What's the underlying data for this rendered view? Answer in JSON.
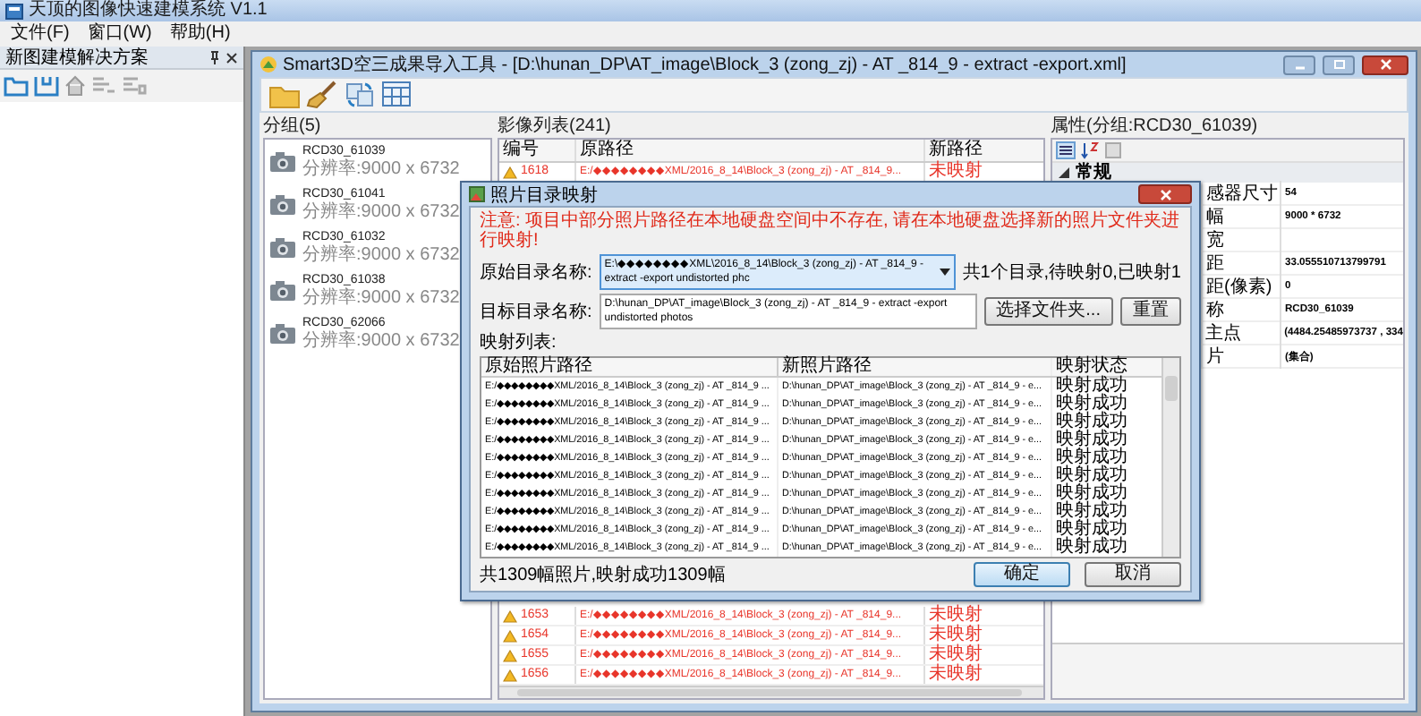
{
  "app": {
    "title": "天顶的图像快速建模系统 V1.1"
  },
  "menu": [
    {
      "label": "文件(F)"
    },
    {
      "label": "窗口(W)"
    },
    {
      "label": "帮助(H)"
    }
  ],
  "solution_panel": {
    "title": "新图建模解决方案"
  },
  "tool_window": {
    "title": "Smart3D空三成果导入工具 - [D:\\hunan_DP\\AT_image\\Block_3 (zong_zj) - AT _814_9 - extract -export.xml]",
    "groups": {
      "title": "分组(5)",
      "items": [
        {
          "name": "RCD30_61039",
          "resolution": "分辨率:9000 x 6732"
        },
        {
          "name": "RCD30_61041",
          "resolution": "分辨率:9000 x 6732"
        },
        {
          "name": "RCD30_61032",
          "resolution": "分辨率:9000 x 6732"
        },
        {
          "name": "RCD30_61038",
          "resolution": "分辨率:9000 x 6732"
        },
        {
          "name": "RCD30_62066",
          "resolution": "分辨率:9000 x 6732"
        }
      ]
    },
    "images": {
      "title": "影像列表(241)",
      "columns": [
        "编号",
        "原路径",
        "新路径"
      ],
      "top_rows": [
        {
          "kind": "warning",
          "number": "1618",
          "source": "E:/◆◆◆◆◆◆◆◆XML/2016_8_14\\Block_3 (zong_zj) - AT _814_9...",
          "target": "未映射"
        }
      ],
      "bottom_rows": [
        {
          "kind": "warning",
          "number": "1653",
          "source": "E:/◆◆◆◆◆◆◆◆XML/2016_8_14\\Block_3 (zong_zj) - AT _814_9...",
          "target": "未映射"
        },
        {
          "kind": "warning",
          "number": "1654",
          "source": "E:/◆◆◆◆◆◆◆◆XML/2016_8_14\\Block_3 (zong_zj) - AT _814_9...",
          "target": "未映射"
        },
        {
          "kind": "warning",
          "number": "1655",
          "source": "E:/◆◆◆◆◆◆◆◆XML/2016_8_14\\Block_3 (zong_zj) - AT _814_9...",
          "target": "未映射"
        },
        {
          "kind": "warning",
          "number": "1656",
          "source": "E:/◆◆◆◆◆◆◆◆XML/2016_8_14\\Block_3 (zong_zj) - AT _814_9...",
          "target": "未映射"
        }
      ]
    },
    "properties": {
      "title": "属性(分组:RCD30_61039)",
      "category": {
        "label": "常规",
        "expanded": true
      },
      "rows": [
        {
          "name": "感器尺寸",
          "value": "54"
        },
        {
          "name": "幅",
          "value": "9000 * 6732"
        },
        {
          "name": "宽",
          "value": ""
        },
        {
          "name": "距",
          "value": "33.055510713799791"
        },
        {
          "name": "距(像素)",
          "value": "0"
        },
        {
          "name": "称",
          "value": "RCD30_61039"
        },
        {
          "name": "主点",
          "value": "(4484.25485973737 , 334"
        },
        {
          "name": "片",
          "value": "(集合)"
        }
      ]
    }
  },
  "dialog": {
    "title": "照片目录映射",
    "warning": "注意: 项目中部分照片路径在本地硬盘空间中不存在, 请在本地硬盘选择新的照片文件夹进行映射!",
    "source_label": "原始目录名称:",
    "source_value": "E:\\◆◆◆◆◆◆◆◆XML\\2016_8_14\\Block_3 (zong_zj) - AT _814_9 - extract -export undistorted phc",
    "summary": "共1个目录,待映射0,已映射1",
    "target_label": "目标目录名称:",
    "target_value": "D:\\hunan_DP\\AT_image\\Block_3 (zong_zj) - AT _814_9 - extract -export undistorted photos",
    "browse_button": "选择文件夹...",
    "reset_button": "重置",
    "list_label": "映射列表:",
    "columns": [
      "原始照片路径",
      "新照片路径",
      "映射状态"
    ],
    "rows": [
      {
        "source": "E:/◆◆◆◆◆◆◆◆XML/2016_8_14\\Block_3 (zong_zj) - AT _814_9 ...",
        "target": "D:\\hunan_DP\\AT_image\\Block_3 (zong_zj) - AT _814_9 - e...",
        "status": "映射成功"
      },
      {
        "source": "E:/◆◆◆◆◆◆◆◆XML/2016_8_14\\Block_3 (zong_zj) - AT _814_9 ...",
        "target": "D:\\hunan_DP\\AT_image\\Block_3 (zong_zj) - AT _814_9 - e...",
        "status": "映射成功"
      },
      {
        "source": "E:/◆◆◆◆◆◆◆◆XML/2016_8_14\\Block_3 (zong_zj) - AT _814_9 ...",
        "target": "D:\\hunan_DP\\AT_image\\Block_3 (zong_zj) - AT _814_9 - e...",
        "status": "映射成功"
      },
      {
        "source": "E:/◆◆◆◆◆◆◆◆XML/2016_8_14\\Block_3 (zong_zj) - AT _814_9 ...",
        "target": "D:\\hunan_DP\\AT_image\\Block_3 (zong_zj) - AT _814_9 - e...",
        "status": "映射成功"
      },
      {
        "source": "E:/◆◆◆◆◆◆◆◆XML/2016_8_14\\Block_3 (zong_zj) - AT _814_9 ...",
        "target": "D:\\hunan_DP\\AT_image\\Block_3 (zong_zj) - AT _814_9 - e...",
        "status": "映射成功"
      },
      {
        "source": "E:/◆◆◆◆◆◆◆◆XML/2016_8_14\\Block_3 (zong_zj) - AT _814_9 ...",
        "target": "D:\\hunan_DP\\AT_image\\Block_3 (zong_zj) - AT _814_9 - e...",
        "status": "映射成功"
      },
      {
        "source": "E:/◆◆◆◆◆◆◆◆XML/2016_8_14\\Block_3 (zong_zj) - AT _814_9 ...",
        "target": "D:\\hunan_DP\\AT_image\\Block_3 (zong_zj) - AT _814_9 - e...",
        "status": "映射成功"
      },
      {
        "source": "E:/◆◆◆◆◆◆◆◆XML/2016_8_14\\Block_3 (zong_zj) - AT _814_9 ...",
        "target": "D:\\hunan_DP\\AT_image\\Block_3 (zong_zj) - AT _814_9 - e...",
        "status": "映射成功"
      },
      {
        "source": "E:/◆◆◆◆◆◆◆◆XML/2016_8_14\\Block_3 (zong_zj) - AT _814_9 ...",
        "target": "D:\\hunan_DP\\AT_image\\Block_3 (zong_zj) - AT _814_9 - e...",
        "status": "映射成功"
      },
      {
        "source": "E:/◆◆◆◆◆◆◆◆XML/2016_8_14\\Block_3 (zong_zj) - AT _814_9 ...",
        "target": "D:\\hunan_DP\\AT_image\\Block_3 (zong_zj) - AT _814_9 - e...",
        "status": "映射成功"
      }
    ],
    "footer": "共1309幅照片,映射成功1309幅",
    "ok_button": "确定",
    "cancel_button": "取消"
  }
}
